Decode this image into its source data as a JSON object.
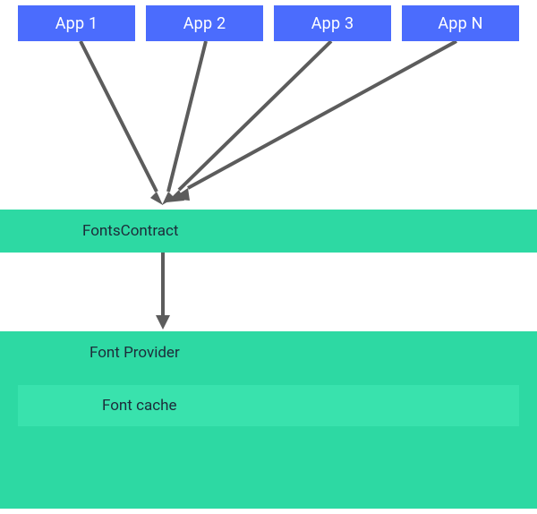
{
  "apps": {
    "labels": [
      "App 1",
      "App 2",
      "App 3",
      "App N"
    ],
    "color": "#4b6cfd"
  },
  "layers": {
    "contract": "FontsContract",
    "provider": "Font Provider",
    "cache": "Font cache"
  },
  "colors": {
    "green_main": "#2dd9a3",
    "green_inner": "#39e2ad",
    "arrow": "#5c5c5c"
  }
}
